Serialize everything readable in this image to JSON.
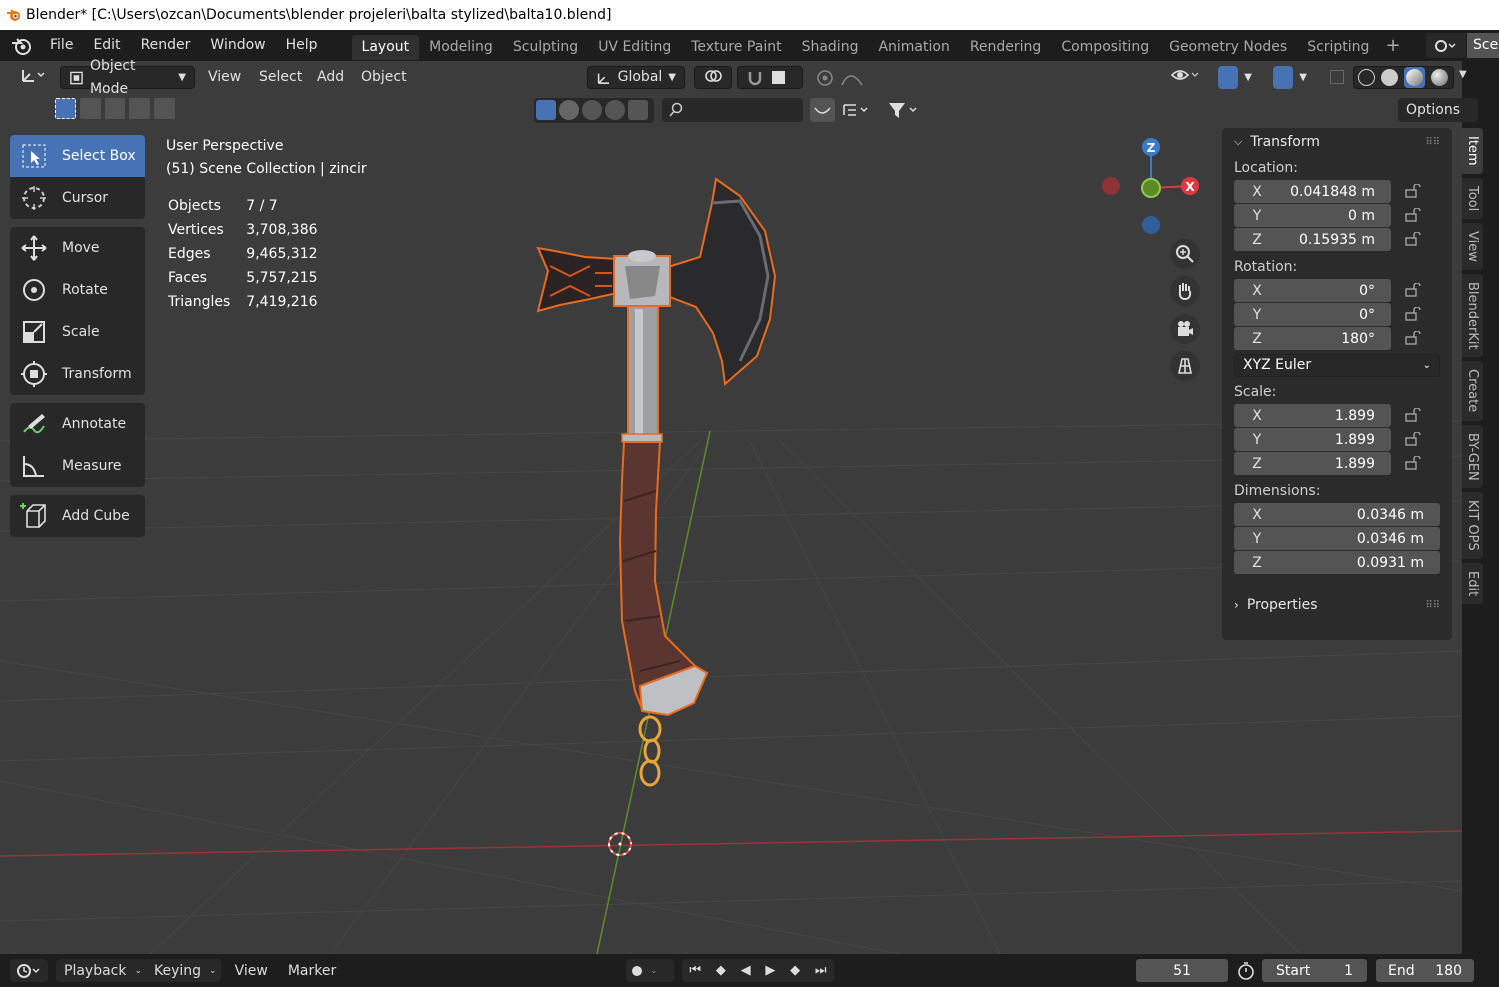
{
  "window": {
    "title": "Blender* [C:\\Users\\ozcan\\Documents\\blender projeleri\\balta stylized\\balta10.blend]"
  },
  "menu": [
    "File",
    "Edit",
    "Render",
    "Window",
    "Help"
  ],
  "workspaces": [
    "Layout",
    "Modeling",
    "Sculpting",
    "UV Editing",
    "Texture Paint",
    "Shading",
    "Animation",
    "Rendering",
    "Compositing",
    "Geometry Nodes",
    "Scripting"
  ],
  "scene_label": "Scen",
  "header": {
    "mode": "Object Mode",
    "view": "View",
    "select": "Select",
    "add": "Add",
    "object": "Object",
    "orientation": "Global",
    "options": "Options"
  },
  "tools": {
    "select_box": "Select Box",
    "cursor": "Cursor",
    "move": "Move",
    "rotate": "Rotate",
    "scale": "Scale",
    "transform": "Transform",
    "annotate": "Annotate",
    "measure": "Measure",
    "add_cube": "Add Cube"
  },
  "viewport_info": {
    "perspective": "User Perspective",
    "collection": "(51) Scene Collection | zincir"
  },
  "stats": [
    {
      "label": "Objects",
      "value": "7 / 7"
    },
    {
      "label": "Vertices",
      "value": "3,708,386"
    },
    {
      "label": "Edges",
      "value": "9,465,312"
    },
    {
      "label": "Faces",
      "value": "5,757,215"
    },
    {
      "label": "Triangles",
      "value": "7,419,216"
    }
  ],
  "gizmo": {
    "z": "Z",
    "x": "X"
  },
  "transform": {
    "title": "Transform",
    "location_label": "Location:",
    "location": {
      "x": "0.041848 m",
      "y": "0 m",
      "z": "0.15935 m"
    },
    "rotation_label": "Rotation:",
    "rotation": {
      "x": "0°",
      "y": "0°",
      "z": "180°"
    },
    "rotation_mode": "XYZ Euler",
    "scale_label": "Scale:",
    "scale": {
      "x": "1.899",
      "y": "1.899",
      "z": "1.899"
    },
    "dimensions_label": "Dimensions:",
    "dimensions": {
      "x": "0.0346 m",
      "y": "0.0346 m",
      "z": "0.0931 m"
    },
    "axes": {
      "x": "X",
      "y": "Y",
      "z": "Z"
    },
    "properties": "Properties"
  },
  "sidebar_tabs": [
    "Item",
    "Tool",
    "View",
    "BlenderKit",
    "Create",
    "BY-GEN",
    "KIT OPS",
    "Edit"
  ],
  "timeline": {
    "playback": "Playback",
    "keying": "Keying",
    "view": "View",
    "marker": "Marker",
    "current_frame": "51",
    "start_label": "Start",
    "start": "1",
    "end_label": "End",
    "end": "180"
  },
  "colors": {
    "accent": "#4772b3",
    "selection_outline": "#e86b1e",
    "axis_x": "#e0383e",
    "axis_y": "#6aab2a",
    "axis_z": "#3a7ccb"
  }
}
